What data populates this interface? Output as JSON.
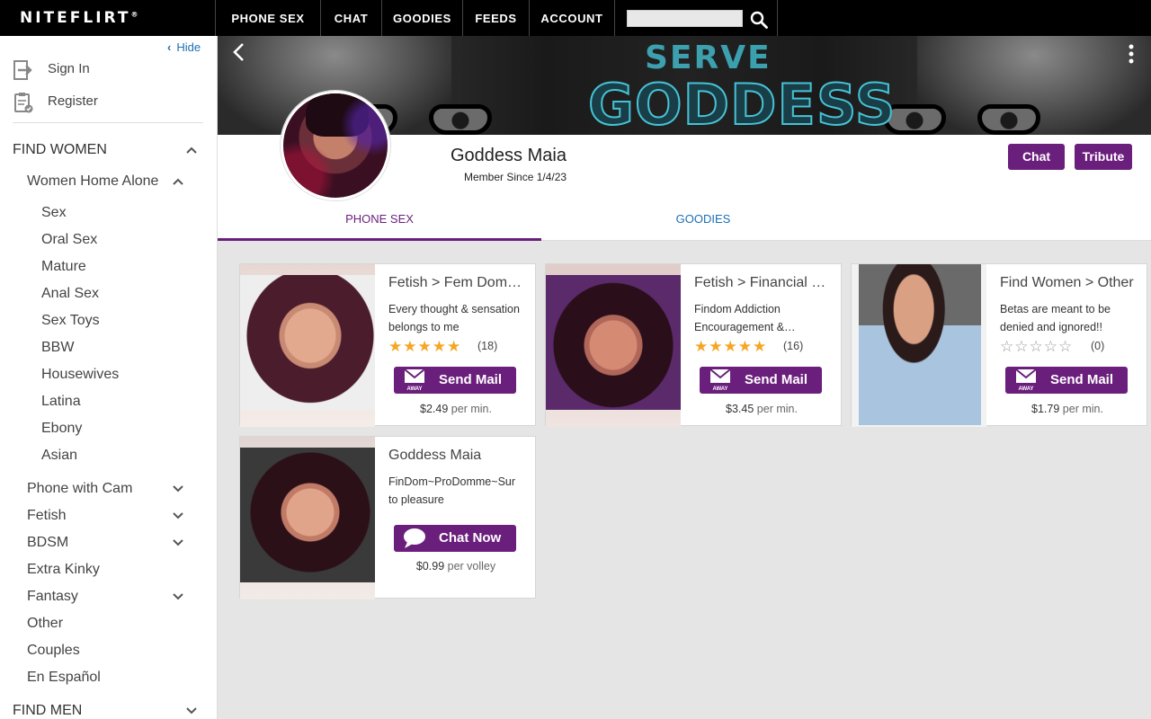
{
  "nav": {
    "logo": "NITEFLIRT",
    "logo_mark": "®",
    "items": [
      "PHONE SEX",
      "CHAT",
      "GOODIES",
      "FEEDS",
      "ACCOUNT"
    ],
    "search_value": ""
  },
  "sidebar": {
    "hide_label": "Hide",
    "sign_in": "Sign In",
    "register": "Register",
    "find_women": "FIND WOMEN",
    "women_home_alone": "Women Home Alone",
    "subcats": [
      "Sex",
      "Oral Sex",
      "Mature",
      "Anal Sex",
      "Sex Toys",
      "BBW",
      "Housewives",
      "Latina",
      "Ebony",
      "Asian"
    ],
    "categories": [
      "Phone with Cam",
      "Fetish",
      "BDSM",
      "Extra Kinky",
      "Fantasy",
      "Other",
      "Couples",
      "En Español"
    ],
    "find_men": "FIND MEN"
  },
  "banner": {
    "line1": "SERVE",
    "line2": "GODDESS"
  },
  "profile": {
    "name": "Goddess Maia",
    "member_since": "Member Since 1/4/23",
    "chat_button": "Chat",
    "tribute_button": "Tribute",
    "tabs": [
      "PHONE SEX",
      "GOODIES"
    ],
    "active_tab": "PHONE SEX"
  },
  "listings": [
    {
      "title": "Fetish > Fem Dom…",
      "desc": "Every thought & sensation belongs to me",
      "rating": 5,
      "reviews": "(18)",
      "button": "Send Mail",
      "button_badge": "AWAY",
      "price": "$2.49",
      "unit": "per min."
    },
    {
      "title": "Fetish > Financial D…",
      "desc": "Findom Addiction Encouragement &…",
      "rating": 5,
      "reviews": "(16)",
      "button": "Send Mail",
      "button_badge": "AWAY",
      "price": "$3.45",
      "unit": "per min."
    },
    {
      "title": "Find Women > Other",
      "desc": "Betas are meant to be denied and ignored!!",
      "rating": 0,
      "reviews": "(0)",
      "button": "Send Mail",
      "button_badge": "AWAY",
      "price": "$1.79",
      "unit": "per min."
    },
    {
      "title": "Goddess Maia",
      "desc": "FinDom~ProDomme~Sur to pleasure",
      "button": "Chat Now",
      "price": "$0.99",
      "unit": "per volley"
    }
  ],
  "colors": {
    "brand_purple": "#6b1f7c",
    "link_blue": "#1a6fb5",
    "star": "#f5a623"
  }
}
